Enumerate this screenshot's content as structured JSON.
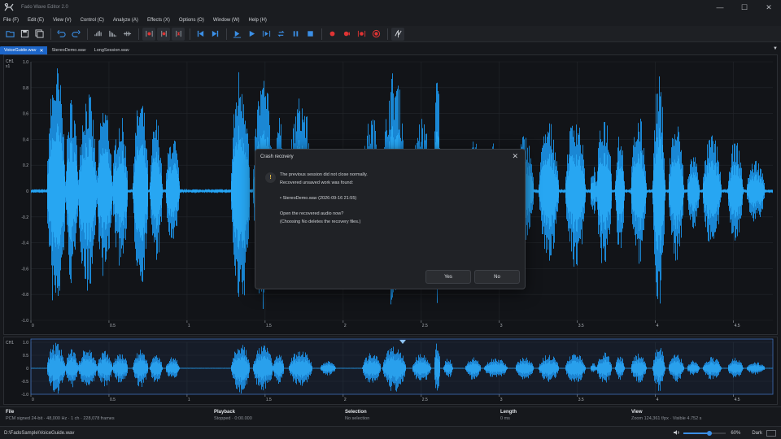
{
  "app": {
    "title": "Fado Wave Editor 2.0"
  },
  "window_controls": {
    "minimize": "—",
    "maximize": "☐",
    "close": "✕"
  },
  "menu": [
    "File (F)",
    "Edit (E)",
    "View (V)",
    "Control (C)",
    "Analyze (A)",
    "Effects (X)",
    "Options (O)",
    "Window (W)",
    "Help (H)"
  ],
  "toolbar": {
    "groups": [
      [
        "open-icon",
        "save-icon",
        "save-all-icon"
      ],
      [
        "undo-icon",
        "redo-icon"
      ],
      [
        "waveform-bars-icon",
        "spectrum-icon",
        "normalize-icon"
      ],
      [
        "marker-red-icon",
        "marker-split-icon",
        "marker-delete-icon"
      ],
      [
        "skip-start-icon",
        "skip-end-icon"
      ],
      [
        "play-from-start-icon",
        "play-icon",
        "play-selection-icon",
        "loop-icon",
        "pause-icon",
        "stop-icon"
      ],
      [
        "record-icon",
        "record-append-icon",
        "record-punch-icon",
        "record-monitor-icon"
      ],
      [
        "mixer-icon"
      ]
    ],
    "colors": {
      "blue": "#3b8fe6",
      "red": "#e03434",
      "gray": "#9aa0a7"
    }
  },
  "tabs": [
    {
      "label": "VoiceGuide.wav",
      "close": "✕",
      "active": true
    },
    {
      "label": "StereoDemo.wav",
      "active": false
    },
    {
      "label": "LongSession.wav",
      "active": false
    }
  ],
  "tabs_menu": "▼",
  "main_view": {
    "channel": "CH1",
    "zoom_y": "x1",
    "y_ticks": [
      "1.0",
      "0.8",
      "0.6",
      "0.4",
      "0.2",
      "0",
      "-0.2",
      "-0.4",
      "-0.6",
      "-0.8",
      "-1.0"
    ],
    "x_ticks": [
      "0",
      "0.5",
      "1",
      "1.5",
      "2",
      "2.5",
      "3",
      "3.5",
      "4",
      "4.5"
    ],
    "wave_color": "#1f9bea"
  },
  "overview": {
    "channel": "CH1",
    "y_ticks": [
      "1.0",
      "0.5",
      "0",
      "-0.5",
      "-1.0"
    ],
    "x_ticks": [
      "0",
      "0.5",
      "1",
      "1.5",
      "2",
      "2.5",
      "3",
      "3.5",
      "4",
      "4.5"
    ]
  },
  "status": {
    "file": {
      "label": "File",
      "value": "PCM signed 24-bit · 48,000 Hz · 1 ch · 228,078 frames"
    },
    "playback": {
      "label": "Playback",
      "value": "Stopped · 0:00.000"
    },
    "selection": {
      "label": "Selection",
      "value": "No selection"
    },
    "length": {
      "label": "Length",
      "value": "0 ms"
    },
    "view": {
      "label": "View",
      "value": "Zoom 124,361 f/px · Visible 4.752 s"
    }
  },
  "bottom": {
    "path": "D:\\FadoSample\\VoiceGuide.wav",
    "zoom_percent": "60%",
    "zoom_level": 0.6,
    "theme": "Dark"
  },
  "dialog": {
    "title": "Crash recovery",
    "close": "✕",
    "icon": "!",
    "line1": "The previous session did not close normally.",
    "line2": "Recovered unsaved work was found:",
    "line3": "",
    "line4": "• StereoDemo.wav (2026-09-16 21:55)",
    "line5": "",
    "line6": "Open the recovered audio now?",
    "line7": "(Choosing No deletes the recovery files.)",
    "yes": "Yes",
    "no": "No"
  }
}
